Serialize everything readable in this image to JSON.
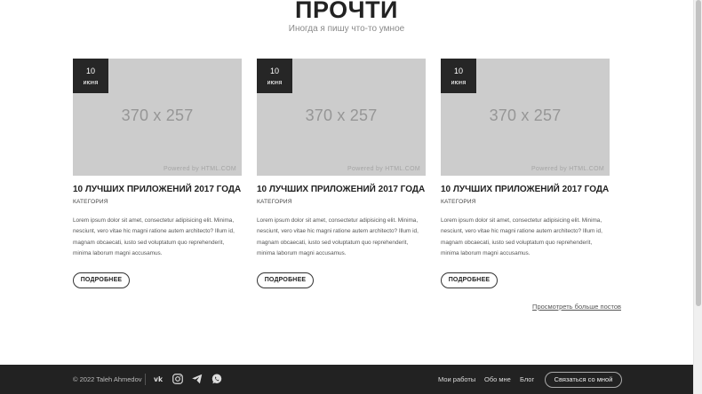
{
  "section": {
    "title": "ПРОЧТИ",
    "subtitle": "Иногда я пишу что-то умное"
  },
  "posts": [
    {
      "day": "10",
      "month": "июня",
      "image_size": "370 x 257",
      "image_credit": "Powered by HTML.COM",
      "title": "10 ЛУЧШИХ ПРИЛОЖЕНИЙ 2017 ГОДА",
      "category": "КАТЕГОРИЯ",
      "excerpt": "Lorem ipsum dolor sit amet, consectetur adipisicing elit. Minima, nesciunt, vero vitae hic magni ratione autem architecto? Illum id, magnam obcaecati, iusto sed voluptatum quo reprehenderit, minima laborum magni accusamus.",
      "button": "ПОДРОБНЕЕ"
    },
    {
      "day": "10",
      "month": "июня",
      "image_size": "370 x 257",
      "image_credit": "Powered by HTML.COM",
      "title": "10 ЛУЧШИХ ПРИЛОЖЕНИЙ 2017 ГОДА",
      "category": "КАТЕГОРИЯ",
      "excerpt": "Lorem ipsum dolor sit amet, consectetur adipisicing elit. Minima, nesciunt, vero vitae hic magni ratione autem architecto? Illum id, magnam obcaecati, iusto sed voluptatum quo reprehenderit, minima laborum magni accusamus.",
      "button": "ПОДРОБНЕЕ"
    },
    {
      "day": "10",
      "month": "июня",
      "image_size": "370 x 257",
      "image_credit": "Powered by HTML.COM",
      "title": "10 ЛУЧШИХ ПРИЛОЖЕНИЙ 2017 ГОДА",
      "category": "КАТЕГОРИЯ",
      "excerpt": "Lorem ipsum dolor sit amet, consectetur adipisicing elit. Minima, nesciunt, vero vitae hic magni ratione autem architecto? Illum id, magnam obcaecati, iusto sed voluptatum quo reprehenderit, minima laborum magni accusamus.",
      "button": "ПОДРОБНЕЕ"
    }
  ],
  "more_posts_link": "Просмотреть больше постов",
  "footer": {
    "copyright": "© 2022 Taleh Ahmedov",
    "social_icons": [
      "vk-icon",
      "instagram-icon",
      "telegram-icon",
      "whatsapp-icon"
    ],
    "nav": [
      "Мои работы",
      "Обо мне",
      "Блог"
    ],
    "contact_button": "Связаться со мной"
  },
  "colors": {
    "footer_bg": "#222222",
    "date_badge_bg": "#262626",
    "placeholder_bg": "#cccccc"
  }
}
